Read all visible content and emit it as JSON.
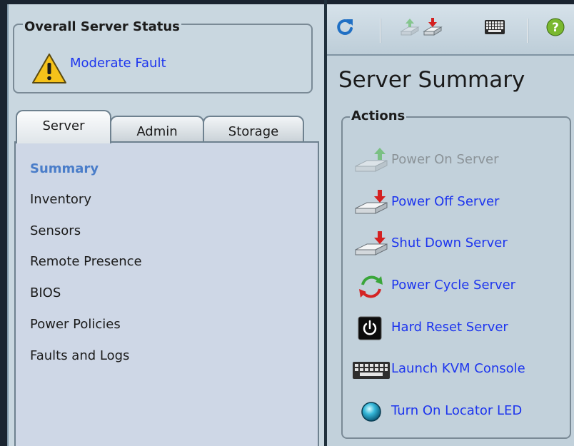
{
  "overall_status": {
    "legend": "Overall Server Status",
    "status": "Moderate Fault",
    "icon": "warning-icon"
  },
  "tabs": [
    {
      "label": "Server",
      "active": true
    },
    {
      "label": "Admin",
      "active": false
    },
    {
      "label": "Storage",
      "active": false
    }
  ],
  "nav": {
    "items": [
      {
        "label": "Summary",
        "active": true
      },
      {
        "label": "Inventory"
      },
      {
        "label": "Sensors"
      },
      {
        "label": "Remote Presence"
      },
      {
        "label": "BIOS"
      },
      {
        "label": "Power Policies"
      },
      {
        "label": "Faults and Logs"
      }
    ]
  },
  "toolbar": {
    "icons": [
      "refresh-icon",
      "power-on-icon",
      "power-off-icon",
      "keyboard-icon",
      "help-icon"
    ]
  },
  "page": {
    "title": "Server Summary"
  },
  "actions": {
    "legend": "Actions",
    "items": [
      {
        "label": "Power On Server",
        "icon": "power-on-icon",
        "enabled": false
      },
      {
        "label": "Power Off Server",
        "icon": "power-off-icon",
        "enabled": true
      },
      {
        "label": "Shut Down Server",
        "icon": "shutdown-icon",
        "enabled": true
      },
      {
        "label": "Power Cycle Server",
        "icon": "power-cycle-icon",
        "enabled": true
      },
      {
        "label": "Hard Reset Server",
        "icon": "hard-reset-icon",
        "enabled": true
      },
      {
        "label": "Launch KVM Console",
        "icon": "keyboard-icon",
        "enabled": true
      },
      {
        "label": "Turn On Locator LED",
        "icon": "locator-led-icon",
        "enabled": true
      }
    ]
  },
  "colors": {
    "link": "#1d35ee",
    "active_nav": "#4a7dc9",
    "disabled": "#8b9398"
  }
}
